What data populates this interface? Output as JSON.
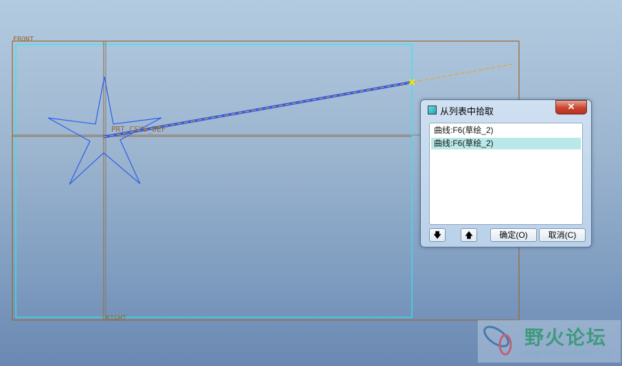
{
  "viewport": {
    "datum_labels": {
      "front": "FRONT",
      "right": "RIGHT",
      "csys": "PRT_CSYS_DEF"
    }
  },
  "dialog": {
    "title": "从列表中拾取",
    "close_label": "✕",
    "items": [
      {
        "label": "曲线:F6(草绘_2)",
        "selected": false
      },
      {
        "label": "曲线:F6(草绘_2)",
        "selected": true
      }
    ],
    "down_label": "🡇",
    "up_label": "🡅",
    "ok_label": "确定(O)",
    "cancel_label": "取消(C)"
  },
  "watermark": {
    "name": "野火论坛",
    "url": "www.proewildfire.cn"
  },
  "colors": {
    "datum": "#9a6632",
    "cyan": "#2fe8ee",
    "curve": "#2a5cf0",
    "highlight": "#ff9a00"
  }
}
